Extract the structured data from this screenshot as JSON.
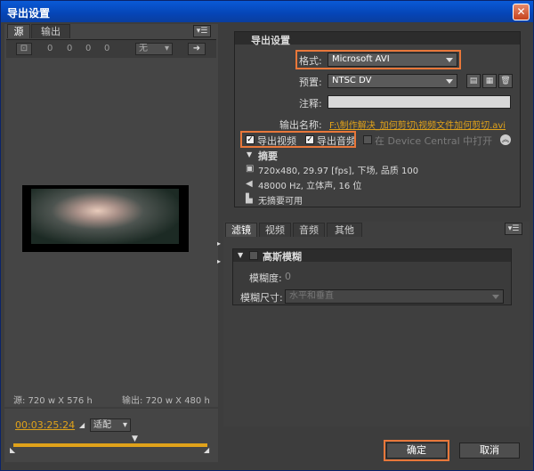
{
  "window": {
    "title": "导出设置",
    "close_glyph": "✕"
  },
  "left": {
    "tabs": [
      "源",
      "输出"
    ],
    "crop_icon": "crop-icon",
    "crop_values": [
      "0",
      "0",
      "0",
      "0"
    ],
    "crop_ratio": "无",
    "source_res": "源: 720 w X 576 h",
    "output_res": "输出: 720 w X 480 h",
    "timecode": "00:03:25:24",
    "fit_select": "适配"
  },
  "export_settings": {
    "header": "导出设置",
    "format_label": "格式:",
    "format_value": "Microsoft AVI",
    "preset_label": "预置:",
    "preset_value": "NTSC DV",
    "comment_label": "注释:",
    "comment_value": "",
    "output_name_label": "输出名称:",
    "output_name_value": "F:\\制作解决_加何剪切\\视频文件加何剪切.avi",
    "export_video_label": "导出视频",
    "export_audio_label": "导出音频",
    "device_central_label": "在 Device Central 中打开",
    "summary_label": "摘要",
    "summary_video": "720x480, 29.97 [fps], 下场, 品质 100",
    "summary_audio": "48000 Hz, 立体声, 16 位",
    "summary_none": "无摘要可用"
  },
  "filter_panel": {
    "tabs": [
      "滤镜",
      "视频",
      "音频",
      "其他"
    ],
    "section_title": "高斯模糊",
    "blurriness_label": "模糊度:",
    "blurriness_value": "0",
    "blur_dim_label": "模糊尺寸:",
    "blur_dim_value": "水平和垂直"
  },
  "buttons": {
    "ok": "确定",
    "cancel": "取消"
  },
  "colors": {
    "accent": "#e8773a",
    "timecode": "#e0a21a",
    "link": "#e0a21a"
  }
}
